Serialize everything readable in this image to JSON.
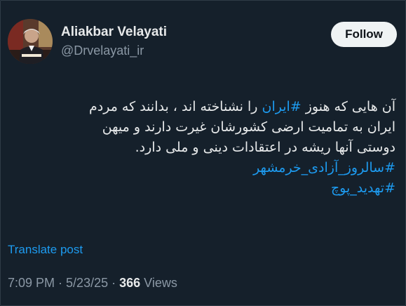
{
  "author": {
    "display_name": "Aliakbar Velayati",
    "handle": "@Drvelayati_ir"
  },
  "follow_label": "Follow",
  "tweet": {
    "line1_pre": "آن هایی که هنوز ",
    "line1_hashtag": "#ایران",
    "line1_post": " را نشناخته اند ،  بدانند که مردم",
    "line2": "ایران به تمامیت ارضی کشورشان غیرت دارند و میهن",
    "line3": "دوستی آنها ریشه در اعتقادات دینی و ملی دارد.",
    "hashtag1": "#سالروز_آزادی_خرمشهر",
    "hashtag2": "#تهدید_پوچ"
  },
  "translate_label": "Translate post",
  "meta": {
    "time": "7:09 PM",
    "sep1": " · ",
    "date": "5/23/25",
    "sep2": " · ",
    "views_count": "366",
    "views_label": " Views"
  },
  "colors": {
    "background": "#15202b",
    "link": "#1d9bf0",
    "text": "#e7e9ea",
    "muted": "#8b98a5"
  }
}
